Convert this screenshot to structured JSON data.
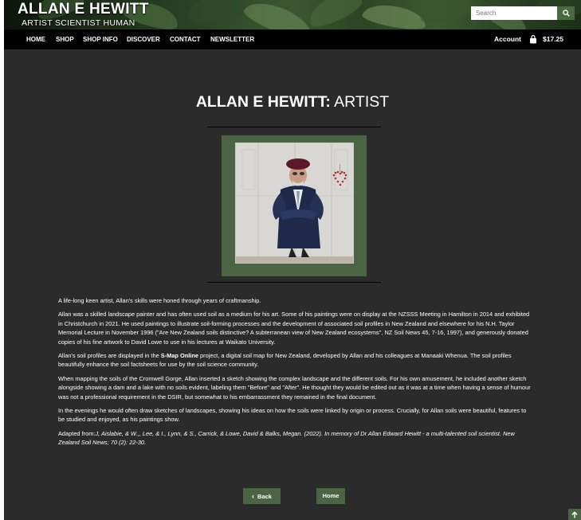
{
  "header": {
    "site_title": "ALLAN E HEWITT",
    "tagline": "ARTIST  SCIENTIST  HUMAN",
    "search_placeholder": "Search"
  },
  "nav": {
    "items": [
      "HOME",
      "SHOP",
      "SHOP INFO",
      "DISCOVER",
      "CONTACT",
      "NEWSLETTER"
    ],
    "account": "Account",
    "cart_total": "$17.25"
  },
  "page": {
    "title_name": "ALLAN E HEWITT:",
    "title_role": " ARTIST"
  },
  "content": {
    "p1": "A life-long keen artist, Allan's skills were honed through years of craftmanship.",
    "p2": "Allan was a skilled landscape painter and has often used soil as a medium for his art. Some of his paintings were on display at the NZSSS Meeting in Hamilton in 2014 and exhibited in Christchurch in 2021. He used paintings to illustrate soil-forming processes and the development of associated soil profiles in New Zealand and elsewhere for his N.H. Taylor Memorial Lecture in November 1996 (\"Are New Zealand soils distinctive? A subterranean view of New Zealand ecosystems\", NZ Soil News 45, 7-16, 1997), and generously donated copies of his fine artwork to David Lowe to use in his lectures at Waikato University.",
    "p3_before": "Allan's soil profiles are displayed in the ",
    "p3_bold": "S-Map Online",
    "p3_after": " project, a digital soil map for New Zealand, developed by Allan and his colleagues at Manaaki Whenua. The soil profiles beautifully enhance the soil factsheets for use by the soil science community.",
    "p4": "When mapping the soils of the Cromwell Gorge, Allan inserted a sketch showing the complex landscape and the different soils. For his own amusement, he included another sketch alongside showing a dam and a lake with no soils evident, labeling them \"Before\" and \"After\". He thought they would be edited out as it was at a time when having a sense of humour was not a professional requirement in the DSIR, but somewhat to his embarrassment they remained in the final document.",
    "p5": "In the evenings he would often draw sketches of landscapes, showing his ideas on how the soils were linked by origin or process. Crucially, for Allan soils were beautiful, features to be studied and enjoyed, as his paintings show.",
    "cite_prefix": "Adapted from:",
    "cite": "J, Aislabie, & W.,, Lee, & I., Lynn, & S., Carrick, & Lowe, David & Balks, Megan. (2022). In memory of Dr Allan Edward Hewitt - a multi-talented soil scientist. New Zealand Soil News; 70 (2): 22-30."
  },
  "buttons": {
    "back": "Back",
    "home": "Home"
  },
  "colors": {
    "accent_green": "#4b6443",
    "page_background": "#2b2b2b",
    "nav_background": "#000000"
  }
}
